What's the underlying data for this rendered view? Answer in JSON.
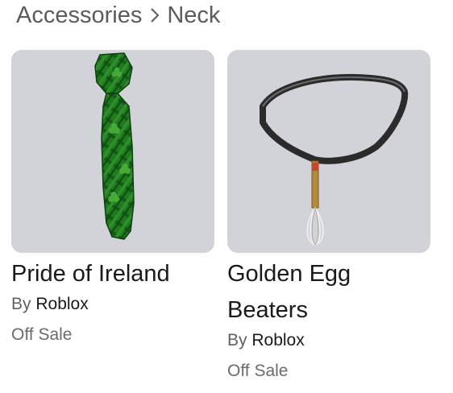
{
  "breadcrumb": {
    "parent": "Accessories",
    "current": "Neck"
  },
  "items": [
    {
      "name": "Pride of Ireland",
      "by_label": "By",
      "creator": "Roblox",
      "price": "Off Sale",
      "icon": "green-shamrock-tie-icon"
    },
    {
      "name": "Golden Egg Beaters",
      "by_label": "By",
      "creator": "Roblox",
      "price": "Off Sale",
      "icon": "necklace-whisk-icon"
    }
  ],
  "colors": {
    "thumbnail_bg": "#d2d3d8",
    "text_primary": "#1a1a1a",
    "text_secondary": "#606060"
  }
}
